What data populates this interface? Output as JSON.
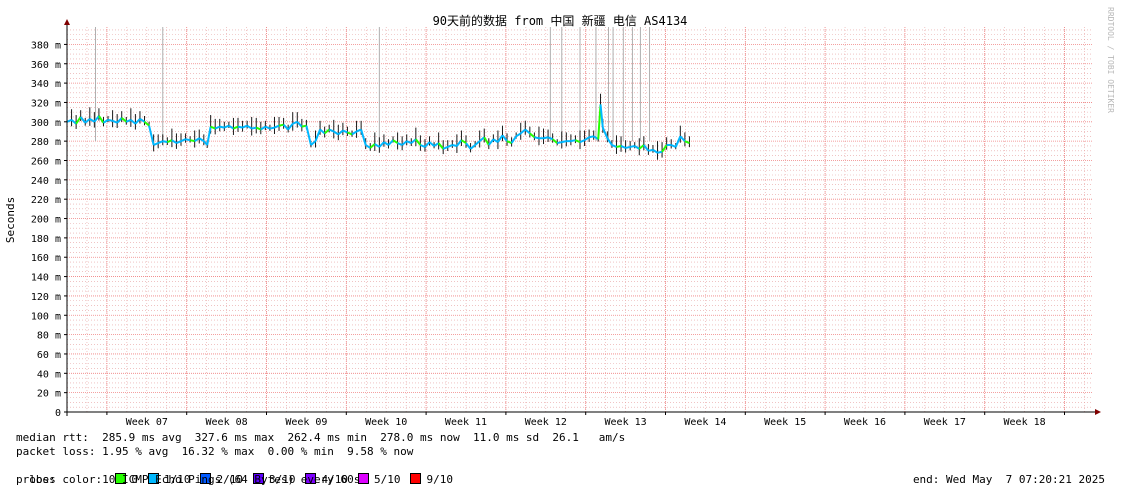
{
  "chart_data": {
    "type": "line",
    "title": "90天前的数据 from 中国 新疆 电信 AS4134",
    "ylabel": "Seconds",
    "watermark": "RRDTOOL / TOBI OETIKER",
    "y_ticks": [
      "0",
      "20 m",
      "40 m",
      "60 m",
      "80 m",
      "100 m",
      "120 m",
      "140 m",
      "160 m",
      "180 m",
      "200 m",
      "220 m",
      "240 m",
      "260 m",
      "280 m",
      "300 m",
      "320 m",
      "340 m",
      "360 m",
      "380 m"
    ],
    "ylim": [
      0,
      398
    ],
    "grid": true,
    "x_labels": [
      "Week 07",
      "Week 08",
      "Week 09",
      "Week 10",
      "Week 11",
      "Week 12",
      "Week 13",
      "Week 14",
      "Week 15",
      "Week 16",
      "Week 17",
      "Week 18"
    ],
    "xlim_days": [
      0,
      90
    ],
    "series": [
      {
        "name": "median rtt",
        "points": [
          [
            0.0,
            300
          ],
          [
            0.4,
            302
          ],
          [
            0.8,
            298
          ],
          [
            1.2,
            305
          ],
          [
            1.6,
            299
          ],
          [
            2.0,
            303
          ],
          [
            2.4,
            300
          ],
          [
            2.8,
            306
          ],
          [
            3.2,
            299
          ],
          [
            3.6,
            302
          ],
          [
            4.0,
            301
          ],
          [
            4.4,
            299
          ],
          [
            4.8,
            304
          ],
          [
            5.2,
            300
          ],
          [
            5.6,
            302
          ],
          [
            6.0,
            298
          ],
          [
            6.4,
            303
          ],
          [
            6.8,
            300
          ],
          [
            7.2,
            296
          ],
          [
            7.6,
            276
          ],
          [
            8.0,
            278
          ],
          [
            8.4,
            280
          ],
          [
            8.8,
            279
          ],
          [
            9.2,
            281
          ],
          [
            9.6,
            278
          ],
          [
            10.0,
            280
          ],
          [
            10.4,
            282
          ],
          [
            10.8,
            281
          ],
          [
            11.2,
            280
          ],
          [
            11.6,
            283
          ],
          [
            12.0,
            280
          ],
          [
            12.3,
            276
          ],
          [
            12.6,
            295
          ],
          [
            13.0,
            293
          ],
          [
            13.4,
            295
          ],
          [
            13.8,
            294
          ],
          [
            14.2,
            296
          ],
          [
            14.6,
            293
          ],
          [
            15.0,
            295
          ],
          [
            15.4,
            294
          ],
          [
            15.8,
            296
          ],
          [
            16.2,
            293
          ],
          [
            16.6,
            294
          ],
          [
            17.0,
            292
          ],
          [
            17.4,
            295
          ],
          [
            17.8,
            293
          ],
          [
            18.2,
            294
          ],
          [
            18.6,
            296
          ],
          [
            19.0,
            297
          ],
          [
            19.4,
            292
          ],
          [
            19.8,
            298
          ],
          [
            20.2,
            300
          ],
          [
            20.6,
            295
          ],
          [
            21.0,
            296
          ],
          [
            21.4,
            276
          ],
          [
            21.8,
            280
          ],
          [
            22.2,
            292
          ],
          [
            22.6,
            288
          ],
          [
            23.0,
            292
          ],
          [
            23.4,
            290
          ],
          [
            23.8,
            287
          ],
          [
            24.2,
            291
          ],
          [
            24.6,
            289
          ],
          [
            25.0,
            287
          ],
          [
            25.4,
            290
          ],
          [
            25.8,
            292
          ],
          [
            26.2,
            276
          ],
          [
            26.6,
            273
          ],
          [
            27.0,
            277
          ],
          [
            27.4,
            274
          ],
          [
            27.8,
            279
          ],
          [
            28.2,
            276
          ],
          [
            28.6,
            281
          ],
          [
            29.0,
            278
          ],
          [
            29.4,
            276
          ],
          [
            29.8,
            280
          ],
          [
            30.2,
            278
          ],
          [
            30.6,
            282
          ],
          [
            31.0,
            276
          ],
          [
            31.4,
            274
          ],
          [
            31.8,
            279
          ],
          [
            32.2,
            275
          ],
          [
            32.6,
            278
          ],
          [
            33.0,
            272
          ],
          [
            33.4,
            274
          ],
          [
            33.8,
            276
          ],
          [
            34.2,
            275
          ],
          [
            34.6,
            281
          ],
          [
            35.0,
            278
          ],
          [
            35.4,
            272
          ],
          [
            35.8,
            276
          ],
          [
            36.2,
            280
          ],
          [
            36.6,
            284
          ],
          [
            37.0,
            276
          ],
          [
            37.4,
            282
          ],
          [
            37.8,
            279
          ],
          [
            38.2,
            286
          ],
          [
            38.6,
            280
          ],
          [
            39.0,
            278
          ],
          [
            39.4,
            285
          ],
          [
            39.8,
            288
          ],
          [
            40.2,
            292
          ],
          [
            40.6,
            288
          ],
          [
            41.0,
            284
          ],
          [
            41.4,
            283
          ],
          [
            41.8,
            283
          ],
          [
            42.2,
            284
          ],
          [
            42.6,
            282
          ],
          [
            43.0,
            278
          ],
          [
            43.4,
            279
          ],
          [
            43.8,
            280
          ],
          [
            44.2,
            280
          ],
          [
            44.6,
            281
          ],
          [
            45.0,
            279
          ],
          [
            45.4,
            281
          ],
          [
            45.8,
            284
          ],
          [
            46.2,
            285
          ],
          [
            46.6,
            282
          ],
          [
            46.8,
            318
          ],
          [
            47.0,
            294
          ],
          [
            47.4,
            283
          ],
          [
            47.8,
            276
          ],
          [
            48.2,
            274
          ],
          [
            48.6,
            275
          ],
          [
            49.0,
            273
          ],
          [
            49.4,
            274
          ],
          [
            49.8,
            275
          ],
          [
            50.2,
            272
          ],
          [
            50.6,
            276
          ],
          [
            51.0,
            270
          ],
          [
            51.4,
            271
          ],
          [
            51.8,
            268
          ],
          [
            52.2,
            269
          ],
          [
            52.6,
            276
          ],
          [
            53.0,
            276
          ],
          [
            53.4,
            274
          ],
          [
            53.8,
            285
          ],
          [
            54.2,
            280
          ],
          [
            54.6,
            278
          ]
        ]
      }
    ]
  },
  "stats": {
    "median_rtt": "median rtt:  285.9 ms avg  327.6 ms max  262.4 ms min  278.0 ms now  11.0 ms sd  26.1   am/s",
    "packet_loss": "packet loss: 1.95 % avg  16.32 % max  0.00 % min  9.58 % now",
    "loss_color_label": "loss color:",
    "probe": "probe:       10 ICMP Echo Pings (64 Bytes) every 60s",
    "end_time": "end: Wed May  7 07:20:21 2025"
  },
  "loss_colors": [
    {
      "label": "0",
      "color": "#26ff00"
    },
    {
      "label": "1/10",
      "color": "#00b8ff"
    },
    {
      "label": "2/10",
      "color": "#0059ff"
    },
    {
      "label": "3/10",
      "color": "#5e00ff"
    },
    {
      "label": "4/10",
      "color": "#7e00ff"
    },
    {
      "label": "5/10",
      "color": "#dd00ff"
    },
    {
      "label": "9/10",
      "color": "#ff0000"
    }
  ],
  "colors": {
    "grid_minor": "#e6a0a0",
    "grid_major": "#f08080",
    "axis": "#000000",
    "arrow": "#800000",
    "loss_spike": "#b0b0b0"
  }
}
